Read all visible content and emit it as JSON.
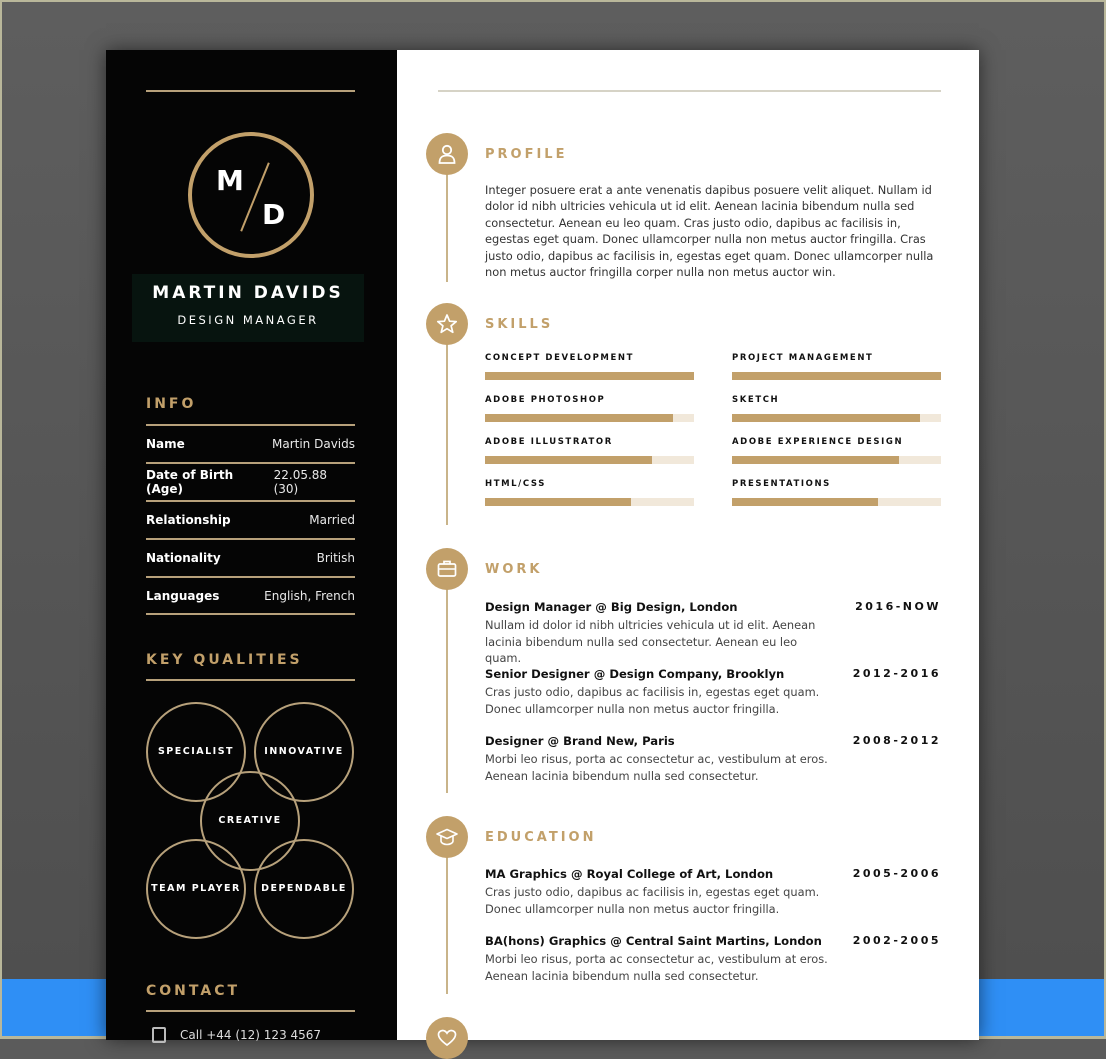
{
  "colors": {
    "accent_gold": "#c2a06a",
    "sidebar_bg": "#050505",
    "name_box_bg": "#07140f",
    "skill_track": "#f1e8da",
    "backdrop_gray": "#5b5b5b",
    "backdrop_blue": "#2f8ff5"
  },
  "header": {
    "monogram_first": "M",
    "monogram_last": "D",
    "name": "MARTIN DAVIDS",
    "job_title": "DESIGN MANAGER"
  },
  "info": {
    "heading": "INFO",
    "rows": [
      {
        "label": "Name",
        "value": "Martin Davids"
      },
      {
        "label": "Date of Birth (Age)",
        "value": "22.05.88 (30)"
      },
      {
        "label": "Relationship",
        "value": "Married"
      },
      {
        "label": "Nationality",
        "value": "British"
      },
      {
        "label": "Languages",
        "value": "English, French"
      }
    ]
  },
  "key_qualities": {
    "heading": "KEY QUALITIES",
    "items": [
      "SPECIALIST",
      "INNOVATIVE",
      "CREATIVE",
      "TEAM PLAYER",
      "DEPENDABLE"
    ]
  },
  "contact": {
    "heading": "CONTACT",
    "items": [
      {
        "icon": "phone-icon",
        "text": "Call +44 (12) 123 4567"
      }
    ]
  },
  "profile": {
    "heading": "PROFILE",
    "icon": "user-icon",
    "text": "Integer posuere erat a ante venenatis dapibus posuere velit aliquet. Nullam id dolor id nibh ultricies vehicula ut id elit. Aenean lacinia bibendum nulla sed consectetur. Aenean eu leo quam. Cras justo odio, dapibus ac facilisis in, egestas eget quam. Donec ullamcorper nulla non metus auctor fringilla. Cras justo odio, dapibus ac facilisis in, egestas eget quam. Donec ullamcorper nulla non metus auctor fringilla corper nulla non metus auctor win."
  },
  "skills": {
    "heading": "SKILLS",
    "icon": "star-icon",
    "items": [
      {
        "label": "CONCEPT DEVELOPMENT",
        "level": 1.0
      },
      {
        "label": "PROJECT MANAGEMENT",
        "level": 1.0
      },
      {
        "label": "ADOBE PHOTOSHOP",
        "level": 0.9
      },
      {
        "label": "SKETCH",
        "level": 0.9
      },
      {
        "label": "ADOBE ILLUSTRATOR",
        "level": 0.8
      },
      {
        "label": "ADOBE EXPERIENCE DESIGN",
        "level": 0.8
      },
      {
        "label": "HTML/CSS",
        "level": 0.7
      },
      {
        "label": "PRESENTATIONS",
        "level": 0.7
      }
    ]
  },
  "work": {
    "heading": "WORK",
    "icon": "briefcase-icon",
    "entries": [
      {
        "title": "Design Manager @ Big Design, London",
        "date": "2016-NOW",
        "desc": "Nullam id dolor id nibh ultricies vehicula ut id elit. Aenean lacinia bibendum nulla sed consectetur. Aenean eu leo quam."
      },
      {
        "title": "Senior Designer @ Design Company, Brooklyn",
        "date": "2012-2016",
        "desc": "Cras justo odio, dapibus ac facilisis in, egestas eget quam. Donec ullamcorper nulla non metus auctor fringilla."
      },
      {
        "title": "Designer @ Brand New, Paris",
        "date": "2008-2012",
        "desc": "Morbi leo risus, porta ac consectetur ac, vestibulum at eros. Aenean lacinia bibendum nulla sed consectetur."
      }
    ]
  },
  "education": {
    "heading": "EDUCATION",
    "icon": "graduation-cap-icon",
    "entries": [
      {
        "title": "MA Graphics @ Royal College of Art, London",
        "date": "2005-2006",
        "desc": "Cras justo odio, dapibus ac facilisis in, egestas eget quam. Donec ullamcorper nulla non metus auctor fringilla."
      },
      {
        "title": "BA(hons) Graphics @ Central Saint Martins, London",
        "date": "2002-2005",
        "desc": "Morbi leo risus, porta ac consectetur ac, vestibulum at eros. Aenean lacinia bibendum nulla sed consectetur."
      }
    ]
  },
  "next_section": {
    "icon": "heart-icon"
  }
}
